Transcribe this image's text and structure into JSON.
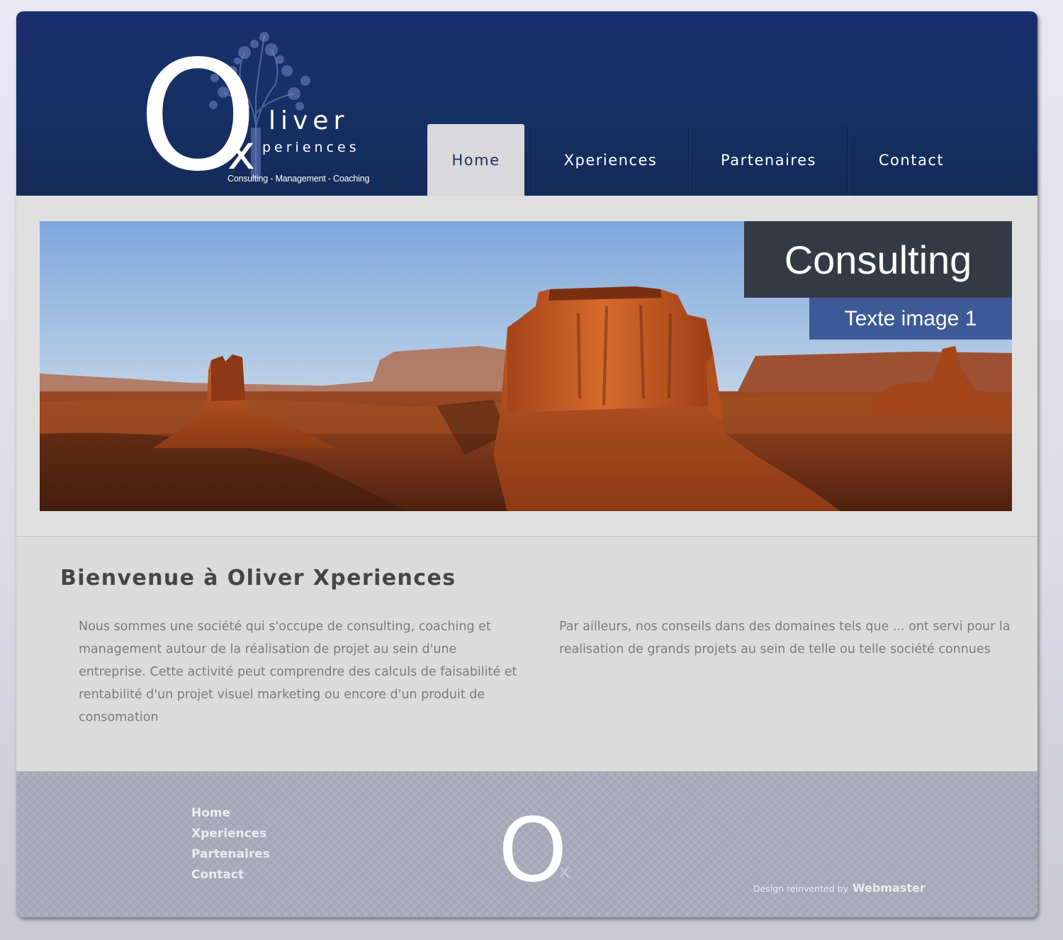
{
  "header": {
    "logo": {
      "letter_o": "O",
      "letter_x": "x",
      "word1": "liver",
      "word2": "periences",
      "tagline": "Consulting - Management - Coaching"
    },
    "nav": [
      {
        "label": "Home",
        "active": true
      },
      {
        "label": "Xperiences",
        "active": false
      },
      {
        "label": "Partenaires",
        "active": false
      },
      {
        "label": "Contact",
        "active": false
      }
    ]
  },
  "banner": {
    "caption_title": "Consulting",
    "caption_subtitle": "Texte image 1"
  },
  "content": {
    "title": "Bienvenue à Oliver Xperiences",
    "col1_text": "Nous sommes une société qui s'occupe de consulting, coaching et management autour de la réalisation de projet au sein d'une entreprise. Cette activité peut comprendre des calculs de faisabilité et rentabilité d'un projet visuel marketing ou encore d'un produit de consomation",
    "col2_text": "Par ailleurs, nos conseils dans des domaines tels que ... ont servi pour la realisation de grands projets au sein de telle ou telle société connues"
  },
  "footer": {
    "links": [
      "Home",
      "Xperiences",
      "Partenaires",
      "Contact"
    ],
    "logo_o": "O",
    "logo_x": "x",
    "credit_prefix": "Design reinvented by",
    "credit_name": "Webmaster"
  },
  "colors": {
    "header_blue": "#163064",
    "caption_dark": "#353b44",
    "caption_blue": "#3d5a97",
    "content_bg": "#dcdbdb",
    "footer_bg": "#a5a6b6"
  },
  "icons": {
    "logo_tree": "tree-icon"
  }
}
